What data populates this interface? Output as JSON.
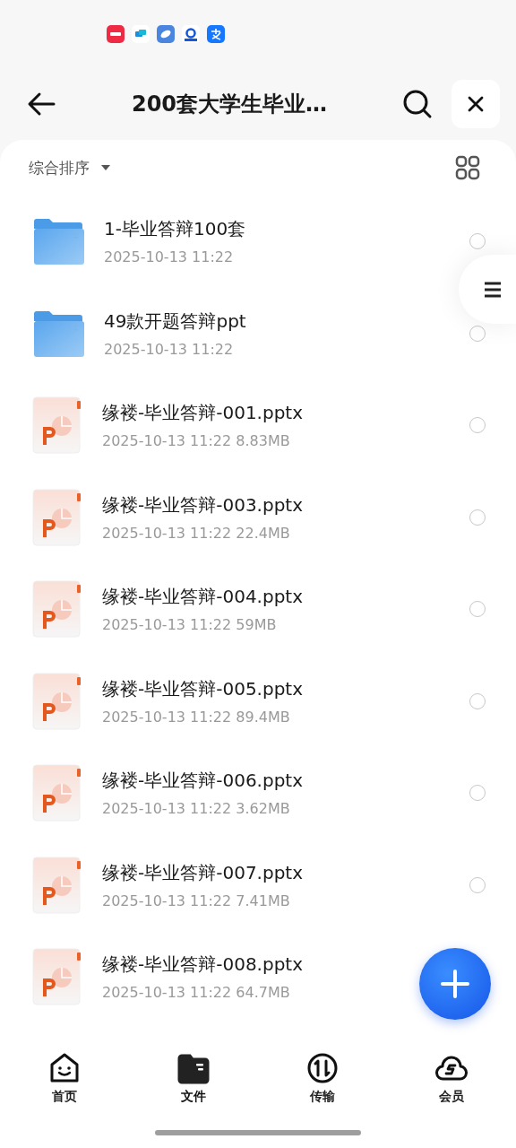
{
  "header": {
    "title": "200套大学生毕业…"
  },
  "sort": {
    "label": "综合排序"
  },
  "files": [
    {
      "kind": "folder",
      "name": "1-毕业答辩100套",
      "date": "2025-10-13 11:22",
      "selected": false
    },
    {
      "kind": "folder",
      "name": "49款开题答辩ppt",
      "date": "2025-10-13 11:22",
      "selected": false
    },
    {
      "kind": "pptx",
      "name": "缘褛-毕业答辩-001.pptx",
      "date": "2025-10-13 11:22",
      "size": "8.83MB",
      "selected": false
    },
    {
      "kind": "pptx",
      "name": "缘褛-毕业答辩-003.pptx",
      "date": "2025-10-13 11:22",
      "size": "22.4MB",
      "selected": false
    },
    {
      "kind": "pptx",
      "name": "缘褛-毕业答辩-004.pptx",
      "date": "2025-10-13 11:22",
      "size": "59MB",
      "selected": false
    },
    {
      "kind": "pptx",
      "name": "缘褛-毕业答辩-005.pptx",
      "date": "2025-10-13 11:22",
      "size": "89.4MB",
      "selected": false
    },
    {
      "kind": "pptx",
      "name": "缘褛-毕业答辩-006.pptx",
      "date": "2025-10-13 11:22",
      "size": "3.62MB",
      "selected": false
    },
    {
      "kind": "pptx",
      "name": "缘褛-毕业答辩-007.pptx",
      "date": "2025-10-13 11:22",
      "size": "7.41MB",
      "selected": false
    },
    {
      "kind": "pptx",
      "name": "缘褛-毕业答辩-008.pptx",
      "date": "2025-10-13 11:22",
      "size": "64.7MB"
    }
  ],
  "nav": [
    {
      "kind": "home",
      "label": "首页",
      "selected": false
    },
    {
      "kind": "files",
      "label": "文件",
      "selected": true
    },
    {
      "kind": "transfer",
      "label": "传输",
      "selected": false
    },
    {
      "kind": "vip",
      "label": "会员",
      "selected": false
    }
  ]
}
